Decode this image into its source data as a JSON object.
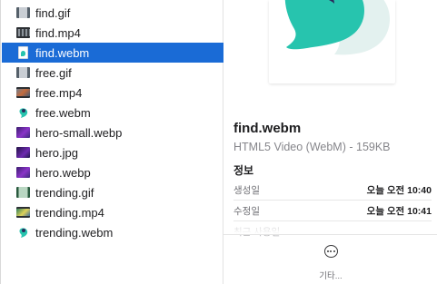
{
  "files": [
    {
      "name": "find.gif",
      "icon": "gif-thumbnail-icon"
    },
    {
      "name": "find.mp4",
      "icon": "video-thumbnail-icon"
    },
    {
      "name": "find.webm",
      "icon": "webm-document-icon",
      "selected": true
    },
    {
      "name": "free.gif",
      "icon": "gif-thumbnail-icon"
    },
    {
      "name": "free.mp4",
      "icon": "video-thumbnail-icon"
    },
    {
      "name": "free.webm",
      "icon": "webm-logo-icon"
    },
    {
      "name": "hero-small.webp",
      "icon": "image-thumbnail-icon"
    },
    {
      "name": "hero.jpg",
      "icon": "image-thumbnail-icon"
    },
    {
      "name": "hero.webp",
      "icon": "image-thumbnail-icon"
    },
    {
      "name": "trending.gif",
      "icon": "gif-thumbnail-icon"
    },
    {
      "name": "trending.mp4",
      "icon": "video-thumbnail-icon"
    },
    {
      "name": "trending.webm",
      "icon": "webm-logo-icon"
    }
  ],
  "preview": {
    "file_name": "find.webm",
    "kind_size": "HTML5 Video (WebM) - 159KB",
    "info_heading": "정보",
    "info": [
      {
        "key": "생성일",
        "value": "오늘 오전 10:40"
      },
      {
        "key": "수정일",
        "value": "오늘 오전 10:41"
      },
      {
        "key": "최근 사용일",
        "value": ""
      }
    ],
    "more_label": "기타..."
  },
  "colors": {
    "selection": "#1a6bd6",
    "logo_teal": "#27c4ae",
    "logo_dark": "#2c2a5c"
  }
}
